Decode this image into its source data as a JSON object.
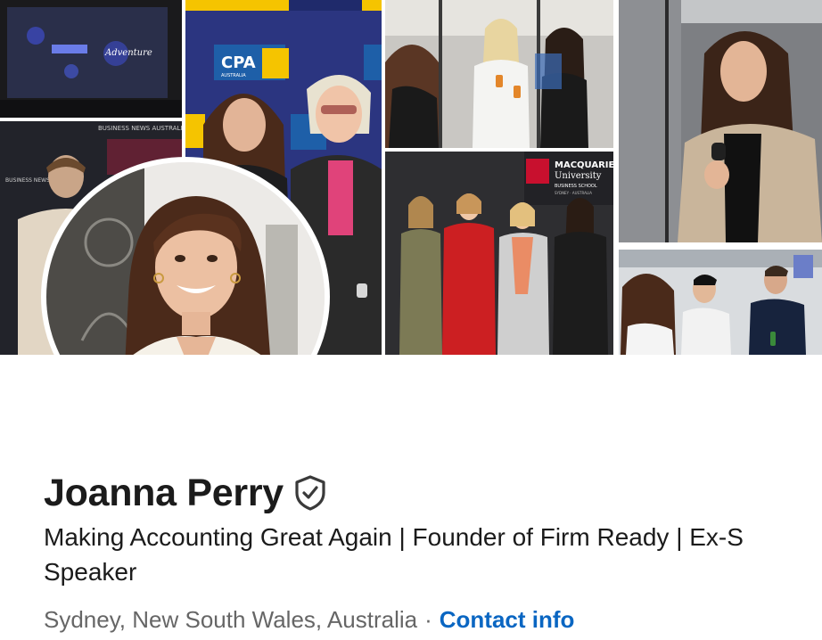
{
  "banner": {
    "screen_caption_left": "Adventure",
    "cpa_logo": "CPA",
    "cpa_subtext": "AUSTRALIA",
    "bna_text": "BUSINESS NEWS AUSTRALIA",
    "macquarie_title": "MACQUARIE",
    "macquarie_sub": "University",
    "macquarie_school": "BUSINESS SCHOOL",
    "macquarie_city": "SYDNEY · AUSTRALIA"
  },
  "profile": {
    "name": "Joanna Perry",
    "verified_icon": "verified-shield-icon",
    "headline_line1": "Making Accounting Great Again | Founder of Firm Ready | Ex-S",
    "headline_line2": "Speaker",
    "location": "Sydney, New South Wales, Australia",
    "separator": "·",
    "contact_label": "Contact info"
  },
  "colors": {
    "text": "#1b1b1b",
    "muted": "#666666",
    "link": "#0a66c2",
    "banner_navy": "#1f2a6b",
    "cpa_yellow": "#f5c400",
    "macquarie_red": "#c8102e"
  }
}
